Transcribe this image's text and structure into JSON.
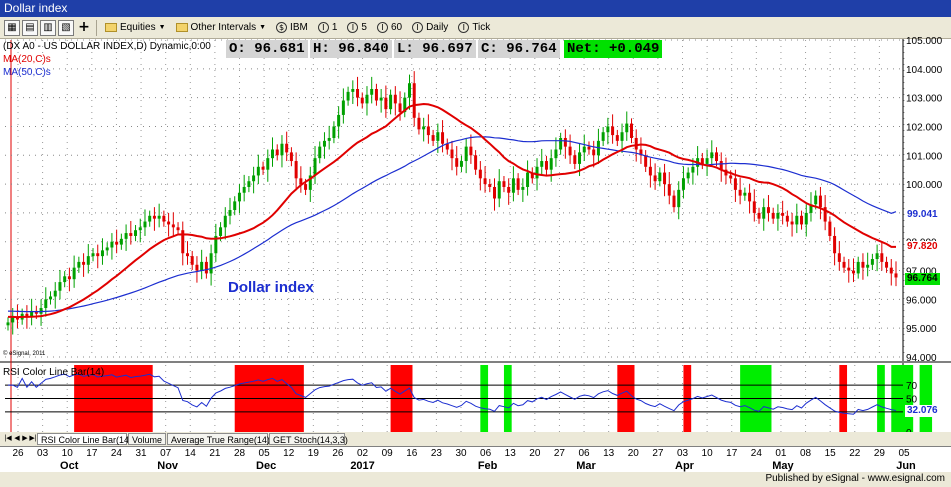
{
  "window": {
    "title": "Dollar index"
  },
  "toolbar": {
    "items": [
      {
        "label": "Equities"
      },
      {
        "label": "Other Intervals"
      },
      {
        "label": "IBM"
      },
      {
        "label": "1"
      },
      {
        "label": "5"
      },
      {
        "label": "60"
      },
      {
        "label": "Daily"
      },
      {
        "label": "Tick"
      }
    ]
  },
  "header": {
    "symbol_line": "(DX A0 - US DOLLAR INDEX,D) Dynamic,0:00",
    "ma20_label": "MA(20,C)s",
    "ma50_label": "MA(50,C)s",
    "open": "O: 96.681",
    "high": "H: 96.840",
    "low": "L: 96.697",
    "close": "C: 96.764",
    "net": "Net: +0.049",
    "copyright": "© eSignal, 2011"
  },
  "annotation": "Dollar index",
  "price_tags": {
    "ma50": "99.041",
    "ma20": "97.820",
    "last": "96.764",
    "rsi": "32.076"
  },
  "colors": {
    "up": "#00a000",
    "down": "#e00000",
    "ma20": "#e00000",
    "ma50": "#1c2ed0",
    "rsi_line": "#1c2ed0",
    "overbought_zone": "#ff0000",
    "oversold_zone": "#00ee00",
    "title_bar": "#1f3fa8",
    "net_bg": "#00e000"
  },
  "rsi_panel": {
    "title": "RSI Color Line Bar(14)",
    "yticks": [
      "70",
      "50",
      "0"
    ]
  },
  "tabs": [
    {
      "label": "RSI Color Line Bar(14)"
    },
    {
      "label": "Volume"
    },
    {
      "label": "Average True Range(14)"
    },
    {
      "label": "GET Stoch(14,3,3)"
    }
  ],
  "footer": {
    "published": "Published by eSignal - www.esignal.com"
  },
  "chart_data": {
    "type": "bar",
    "ylim": [
      94,
      105
    ],
    "yticks": [
      "105.000",
      "104.000",
      "103.000",
      "102.000",
      "101.000",
      "100.000",
      "99.000",
      "98.000",
      "97.000",
      "96.000",
      "95.000",
      "94.000"
    ],
    "x_day_labels": [
      "26",
      "03",
      "10",
      "17",
      "24",
      "31",
      "07",
      "14",
      "21",
      "28",
      "05",
      "12",
      "19",
      "26",
      "02",
      "09",
      "16",
      "23",
      "30",
      "06",
      "13",
      "20",
      "27",
      "06",
      "13",
      "20",
      "27",
      "03",
      "10",
      "17",
      "24",
      "01",
      "08",
      "15",
      "22",
      "29",
      "05"
    ],
    "x_month_labels": [
      "Oct",
      "Nov",
      "Dec",
      "2017",
      "Feb",
      "Mar",
      "Apr",
      "May",
      "Jun"
    ],
    "closes": [
      95.2,
      95.4,
      95.3,
      95.5,
      95.4,
      95.6,
      95.5,
      95.7,
      96.0,
      96.1,
      96.3,
      96.6,
      96.8,
      96.7,
      97.1,
      97.3,
      97.2,
      97.5,
      97.6,
      97.5,
      97.7,
      97.8,
      98.0,
      97.9,
      98.1,
      98.3,
      98.2,
      98.4,
      98.5,
      98.7,
      98.9,
      98.8,
      98.9,
      98.7,
      98.6,
      98.5,
      98.4,
      97.6,
      97.5,
      97.2,
      97.0,
      97.3,
      96.9,
      97.6,
      98.2,
      98.5,
      98.9,
      99.1,
      99.4,
      99.7,
      99.9,
      100.1,
      100.3,
      100.6,
      100.5,
      100.9,
      101.2,
      101.0,
      101.4,
      101.1,
      100.8,
      100.2,
      100.0,
      99.8,
      100.3,
      100.9,
      101.3,
      101.5,
      101.6,
      102.0,
      102.4,
      102.9,
      103.2,
      103.3,
      103.0,
      102.8,
      103.1,
      103.3,
      102.9,
      103.0,
      102.6,
      103.1,
      102.8,
      102.5,
      103.0,
      103.5,
      102.3,
      101.9,
      102.0,
      101.7,
      101.5,
      101.8,
      101.4,
      101.2,
      100.9,
      100.6,
      100.8,
      101.3,
      101.0,
      100.5,
      100.2,
      100.0,
      99.9,
      99.5,
      100.1,
      99.9,
      99.7,
      100.2,
      99.8,
      99.9,
      100.4,
      100.2,
      100.6,
      100.8,
      100.5,
      100.9,
      101.2,
      101.6,
      101.3,
      101.0,
      100.7,
      101.1,
      101.3,
      101.2,
      101.0,
      101.5,
      101.8,
      102.0,
      101.7,
      101.5,
      101.8,
      102.1,
      101.6,
      101.2,
      101.0,
      100.6,
      100.3,
      100.1,
      100.4,
      100.0,
      99.6,
      99.2,
      99.8,
      100.2,
      100.4,
      100.6,
      100.9,
      100.7,
      100.9,
      101.1,
      100.8,
      100.5,
      100.3,
      100.2,
      99.8,
      99.6,
      99.7,
      99.4,
      99.0,
      98.8,
      99.2,
      99.0,
      98.8,
      99.0,
      98.9,
      98.7,
      98.6,
      98.9,
      98.6,
      99.0,
      99.3,
      99.6,
      99.2,
      98.7,
      98.2,
      97.6,
      97.3,
      97.1,
      97.0,
      96.9,
      97.3,
      97.1,
      97.2,
      97.4,
      97.6,
      97.3,
      97.1,
      96.9,
      96.76
    ],
    "ma20_start": 95.4,
    "ma50_start": 95.6,
    "ma20_last": 97.82,
    "ma50_last": 99.041,
    "last_close": 96.764,
    "rsi_ylim": [
      0,
      100
    ],
    "rsi_levels": [
      70,
      50,
      30
    ],
    "rsi_last": 32.076,
    "overbought_ranges": [
      [
        14,
        30
      ],
      [
        48,
        62
      ],
      [
        81,
        85
      ],
      [
        129,
        132
      ],
      [
        143,
        144
      ],
      [
        176,
        177
      ]
    ],
    "oversold_ranges": [
      [
        100,
        101
      ],
      [
        105,
        106
      ],
      [
        155,
        161
      ],
      [
        184,
        185
      ],
      [
        187,
        191
      ],
      [
        193,
        195
      ],
      [
        212,
        218
      ]
    ]
  }
}
